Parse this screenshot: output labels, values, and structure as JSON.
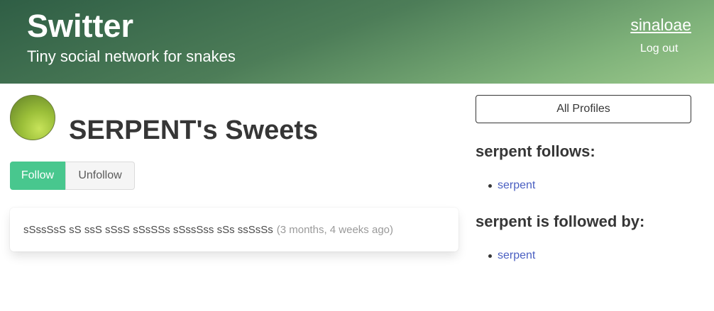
{
  "header": {
    "title": "Switter",
    "subtitle": "Tiny social network for snakes",
    "username": "sinaloae",
    "logout_label": "Log out"
  },
  "profile": {
    "title": "SERPENT's Sweets",
    "follow_label": "Follow",
    "unfollow_label": "Unfollow"
  },
  "sweets": [
    {
      "text": "sSssSsS sS ssS sSsS sSsSSs sSssSss sSs ssSsSs",
      "time": "(3 months, 4 weeks ago)"
    }
  ],
  "sidebar": {
    "all_profiles_label": "All Profiles",
    "follows_heading": "serpent follows:",
    "follows": [
      "serpent"
    ],
    "followed_by_heading": "serpent is followed by:",
    "followed_by": [
      "serpent"
    ]
  },
  "colors": {
    "follow_button": "#48c78e",
    "link": "#4a5fc1",
    "hero_start": "#2f5e45",
    "hero_end": "#9cc98c"
  }
}
